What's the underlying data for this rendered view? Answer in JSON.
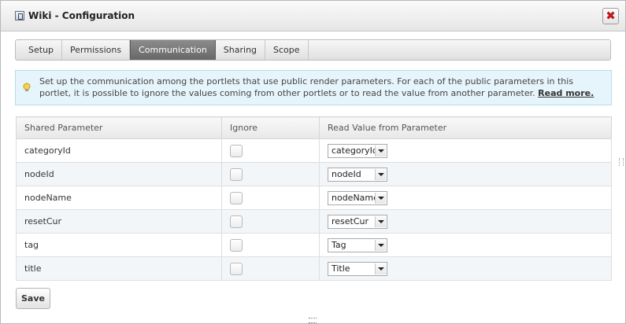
{
  "dialog": {
    "title": "Wiki - Configuration",
    "close_label": "✖"
  },
  "tabs": [
    {
      "label": "Setup",
      "active": false
    },
    {
      "label": "Permissions",
      "active": false
    },
    {
      "label": "Communication",
      "active": true
    },
    {
      "label": "Sharing",
      "active": false
    },
    {
      "label": "Scope",
      "active": false
    }
  ],
  "info": {
    "text": "Set up the communication among the portlets that use public render parameters. For each of the public parameters in this portlet, it is possible to ignore the values coming from other portlets or to read the value from another parameter.",
    "link": "Read more."
  },
  "table": {
    "headers": [
      "Shared Parameter",
      "Ignore",
      "Read Value from Parameter"
    ],
    "rows": [
      {
        "param": "categoryId",
        "ignore": false,
        "read_from": "categoryId"
      },
      {
        "param": "nodeId",
        "ignore": false,
        "read_from": "nodeId"
      },
      {
        "param": "nodeName",
        "ignore": false,
        "read_from": "nodeName"
      },
      {
        "param": "resetCur",
        "ignore": false,
        "read_from": "resetCur"
      },
      {
        "param": "tag",
        "ignore": false,
        "read_from": "Tag"
      },
      {
        "param": "title",
        "ignore": false,
        "read_from": "Title"
      }
    ]
  },
  "actions": {
    "save_label": "Save"
  }
}
